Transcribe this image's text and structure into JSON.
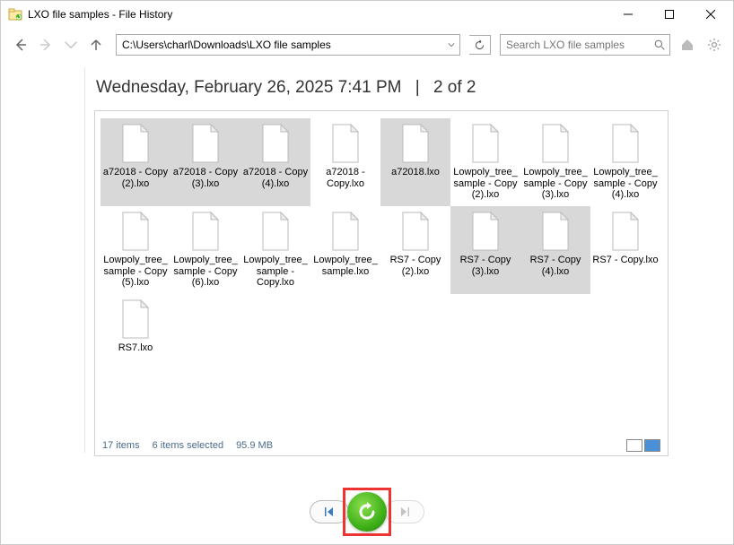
{
  "window": {
    "title": "LXO file samples - File History"
  },
  "nav": {
    "path": "C:\\Users\\charl\\Downloads\\LXO file samples",
    "search_placeholder": "Search LXO file samples"
  },
  "heading": {
    "timestamp": "Wednesday, February 26, 2025 7:41 PM",
    "position": "2 of 2"
  },
  "status": {
    "count": "17 items",
    "selection": "6 items selected",
    "size": "95.9 MB"
  },
  "files": [
    {
      "name": "a72018 - Copy (2).lxo",
      "selected": true
    },
    {
      "name": "a72018 - Copy (3).lxo",
      "selected": true
    },
    {
      "name": "a72018 - Copy (4).lxo",
      "selected": true
    },
    {
      "name": "a72018 - Copy.lxo",
      "selected": false
    },
    {
      "name": "a72018.lxo",
      "selected": true
    },
    {
      "name": "Lowpoly_tree_sample - Copy (2).lxo",
      "selected": false
    },
    {
      "name": "Lowpoly_tree_sample - Copy (3).lxo",
      "selected": false
    },
    {
      "name": "Lowpoly_tree_sample - Copy (4).lxo",
      "selected": false
    },
    {
      "name": "Lowpoly_tree_sample - Copy (5).lxo",
      "selected": false
    },
    {
      "name": "Lowpoly_tree_sample - Copy (6).lxo",
      "selected": false
    },
    {
      "name": "Lowpoly_tree_sample - Copy.lxo",
      "selected": false
    },
    {
      "name": "Lowpoly_tree_sample.lxo",
      "selected": false
    },
    {
      "name": "RS7 - Copy (2).lxo",
      "selected": false
    },
    {
      "name": "RS7 - Copy (3).lxo",
      "selected": true
    },
    {
      "name": "RS7 - Copy (4).lxo",
      "selected": true
    },
    {
      "name": "RS7 - Copy.lxo",
      "selected": false
    },
    {
      "name": "RS7.lxo",
      "selected": false
    }
  ]
}
